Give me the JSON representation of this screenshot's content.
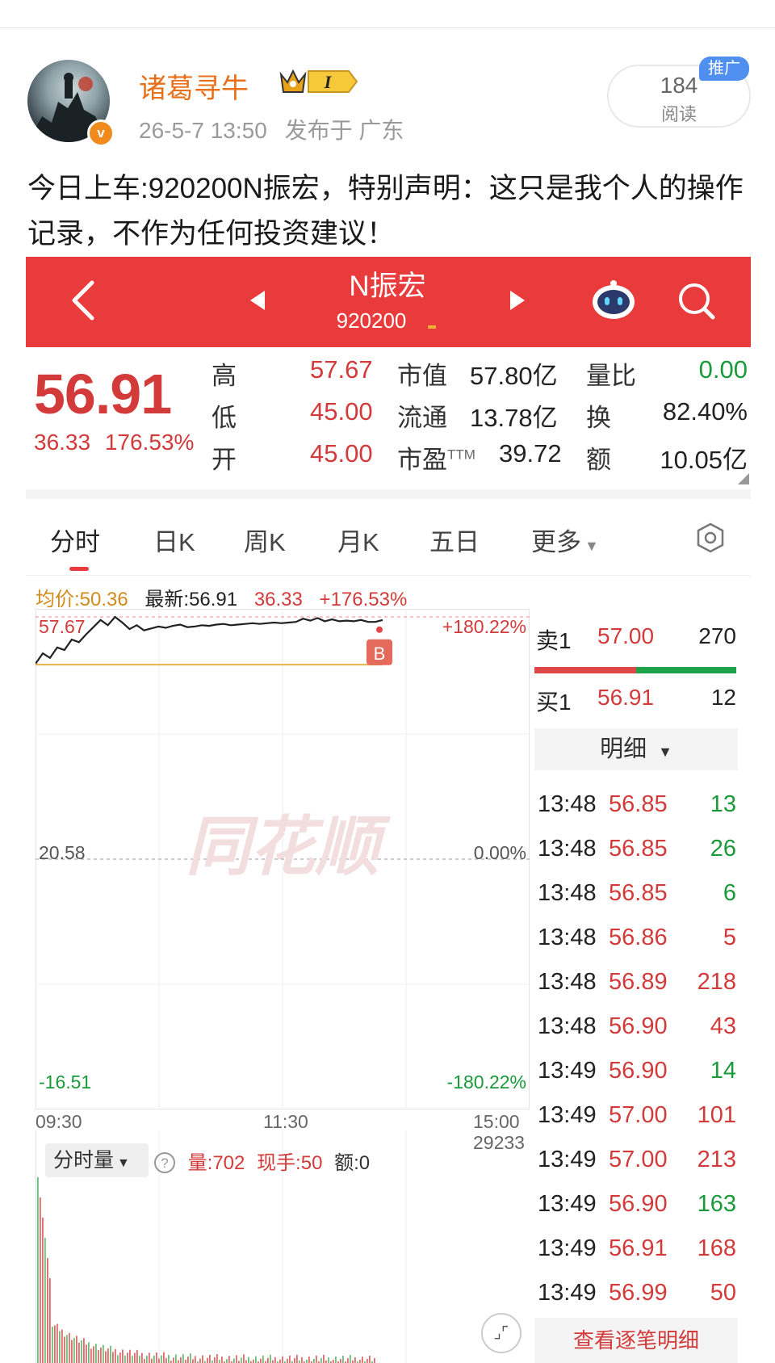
{
  "post": {
    "username": "诸葛寻牛",
    "level_badge": "I",
    "verified_badge": "v",
    "timestamp": "26-5-7 13:50",
    "location": "发布于 广东",
    "read_count": "184",
    "read_label": "阅读",
    "promo_tag": "推广",
    "text": "今日上车:920200N振宏，特别声明：这只是我个人的操作记录，不作为任何投资建议！"
  },
  "stock_header": {
    "name": "N振宏",
    "code": "920200",
    "icons": [
      "back-chevron-icon",
      "prev-stock-arrow-icon",
      "next-stock-arrow-icon",
      "robot-assistant-icon",
      "search-icon"
    ],
    "bar_color": "#e93b3b"
  },
  "quote": {
    "price": "56.91",
    "change": "36.33",
    "change_pct": "176.53%",
    "rows": [
      {
        "l1": "高",
        "v1": "57.67",
        "l2": "市值",
        "v2": "57.80亿",
        "l3": "量比",
        "v3": "0.00"
      },
      {
        "l1": "低",
        "v1": "45.00",
        "l2": "流通",
        "v2": "13.78亿",
        "l3": "换",
        "v3": "82.40%"
      },
      {
        "l1": "开",
        "v1": "45.00",
        "l2": "市盈",
        "l2sup": "TTM",
        "v2": "39.72",
        "l3": "额",
        "v3": "10.05亿"
      }
    ]
  },
  "tabs": {
    "items": [
      "分时",
      "日K",
      "周K",
      "月K",
      "五日",
      "更多"
    ],
    "active": "分时",
    "settings_icon": "hexagon-settings-icon"
  },
  "chart_info": {
    "avg_label": "均价:50.36",
    "latest_label": "最新:56.91",
    "change": "36.33",
    "change_pct": "+176.53%"
  },
  "chart_data": {
    "type": "line",
    "y_labels": {
      "top": "57.67",
      "mid": "20.58",
      "bottom": "-16.51"
    },
    "pct_labels": {
      "top": "+180.22%",
      "mid": "0.00%",
      "bottom": "-180.22%"
    },
    "x_labels": [
      "09:30",
      "11:30",
      "15:00"
    ],
    "ylim": [
      -16.51,
      57.67
    ],
    "watermark": "同花顺",
    "marker": "B",
    "series": [
      {
        "values": [
          50.5,
          52.1,
          51.4,
          53.0,
          52.6,
          54.2,
          53.8,
          55.0,
          56.1,
          57.2,
          56.4,
          57.67,
          56.8,
          55.8,
          56.4,
          55.6,
          55.9,
          56.2,
          56.0,
          56.3,
          56.5,
          56.1,
          56.2,
          56.4,
          56.3,
          56.5,
          56.6,
          56.4,
          56.5,
          56.6,
          56.7,
          56.6,
          56.7,
          56.8,
          56.7,
          56.8,
          56.9,
          57.4,
          57.1,
          57.5,
          57.0,
          57.3,
          57.0,
          57.1,
          57.0,
          57.2,
          56.9,
          56.9,
          57.2
        ]
      },
      {
        "values": [
          50.36,
          50.36
        ]
      }
    ]
  },
  "volume": {
    "selector_label": "分时量",
    "help_icon": "question-circle-icon",
    "vol_label": "量:702",
    "hand_label": "现手:50",
    "amount_label": "额:0",
    "max": "29233"
  },
  "orderbook": {
    "sell": {
      "label": "卖1",
      "price": "57.00",
      "qty": "270"
    },
    "buy": {
      "label": "买1",
      "price": "56.91",
      "qty": "12"
    },
    "detail_label": "明细",
    "sell_color": "#e04848",
    "buy_color": "#1fa34a"
  },
  "trades": [
    {
      "time": "13:48",
      "price": "56.85",
      "qty": "13",
      "dir": "green"
    },
    {
      "time": "13:48",
      "price": "56.85",
      "qty": "26",
      "dir": "green"
    },
    {
      "time": "13:48",
      "price": "56.85",
      "qty": "6",
      "dir": "green"
    },
    {
      "time": "13:48",
      "price": "56.86",
      "qty": "5",
      "dir": "red"
    },
    {
      "time": "13:48",
      "price": "56.89",
      "qty": "218",
      "dir": "red"
    },
    {
      "time": "13:48",
      "price": "56.90",
      "qty": "43",
      "dir": "red"
    },
    {
      "time": "13:49",
      "price": "56.90",
      "qty": "14",
      "dir": "green"
    },
    {
      "time": "13:49",
      "price": "57.00",
      "qty": "101",
      "dir": "red"
    },
    {
      "time": "13:49",
      "price": "57.00",
      "qty": "213",
      "dir": "red"
    },
    {
      "time": "13:49",
      "price": "56.90",
      "qty": "163",
      "dir": "green"
    },
    {
      "time": "13:49",
      "price": "56.91",
      "qty": "168",
      "dir": "red"
    },
    {
      "time": "13:49",
      "price": "56.99",
      "qty": "50",
      "dir": "red"
    }
  ],
  "view_all_label": "查看逐笔明细"
}
